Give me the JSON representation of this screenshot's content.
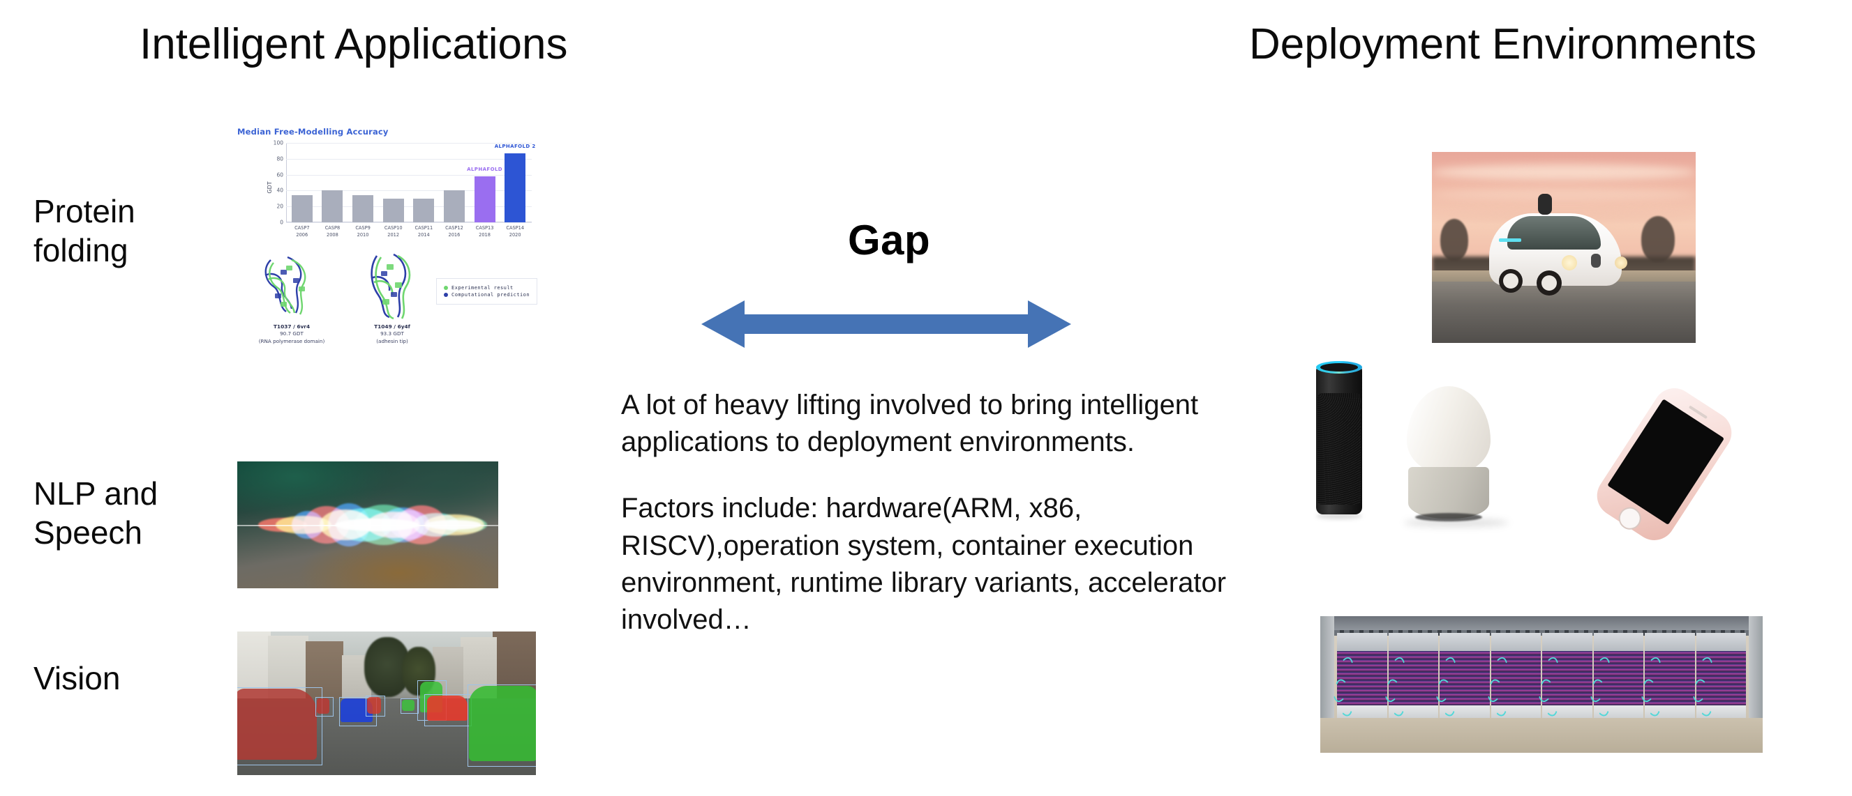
{
  "slide": {
    "left_column_title": "Intelligent Applications",
    "right_column_title": "Deployment Environments",
    "gap_label": "Gap"
  },
  "left_rows": [
    {
      "label_line1": "Protein",
      "label_line2": "folding",
      "figure": "alphafold-accuracy-chart"
    },
    {
      "label_line1": "NLP and",
      "label_line2": "Speech",
      "figure": "siri-waveform-photo"
    },
    {
      "label_line1": "Vision",
      "label_line2": "",
      "figure": "street-scene-segmentation-photo"
    }
  ],
  "center": {
    "paragraph1": "A lot of heavy lifting involved to bring intelligent applications to deployment environments.",
    "paragraph2": "Factors include: hardware(ARM, x86, RISCV),operation system, container execution environment, runtime library variants, accelerator involved…",
    "arrow_color": "#4573b5",
    "arrow_name": "double-headed-arrow"
  },
  "right_items": [
    {
      "name": "self-driving-car-photo"
    },
    {
      "name": "smart-speakers-and-phone-photo"
    },
    {
      "name": "tpu-datacenter-rack-photo"
    }
  ],
  "chart_data": {
    "type": "bar",
    "title": "Median Free-Modelling Accuracy",
    "xlabel": "",
    "ylabel": "GDT",
    "ylim": [
      0,
      100
    ],
    "yticks": [
      0,
      20,
      40,
      60,
      80,
      100
    ],
    "grid": true,
    "legend_position": "bottom-right",
    "categories": [
      "CASP7",
      "CASP8",
      "CASP9",
      "CASP10",
      "CASP11",
      "CASP12",
      "CASP13",
      "CASP14"
    ],
    "category_years": [
      "2006",
      "2008",
      "2010",
      "2012",
      "2014",
      "2016",
      "2018",
      "2020"
    ],
    "values": [
      34,
      40.5,
      34,
      30,
      30,
      40.5,
      58,
      87
    ],
    "bar_colors": [
      "#a9aebc",
      "#a9aebc",
      "#a9aebc",
      "#a9aebc",
      "#a9aebc",
      "#a9aebc",
      "#9a6ef0",
      "#2d55d4"
    ],
    "annotations": [
      {
        "index": 6,
        "text": "ALPHAFOLD",
        "color": "#9a6ef0"
      },
      {
        "index": 7,
        "text": "ALPHAFOLD 2",
        "color": "#2d55d4"
      }
    ],
    "title_color": "#3b63d4",
    "legend": [
      {
        "label": "Experimental result",
        "color": "#6fd66f"
      },
      {
        "label": "Computational prediction",
        "color": "#2d3fa8"
      }
    ],
    "protein_panels": [
      {
        "name": "T1037 / 6vr4",
        "score": "90.7 GDT",
        "description": "(RNA polymerase domain)"
      },
      {
        "name": "T1049 / 6y4f",
        "score": "93.3 GDT",
        "description": "(adhesin tip)"
      }
    ]
  }
}
